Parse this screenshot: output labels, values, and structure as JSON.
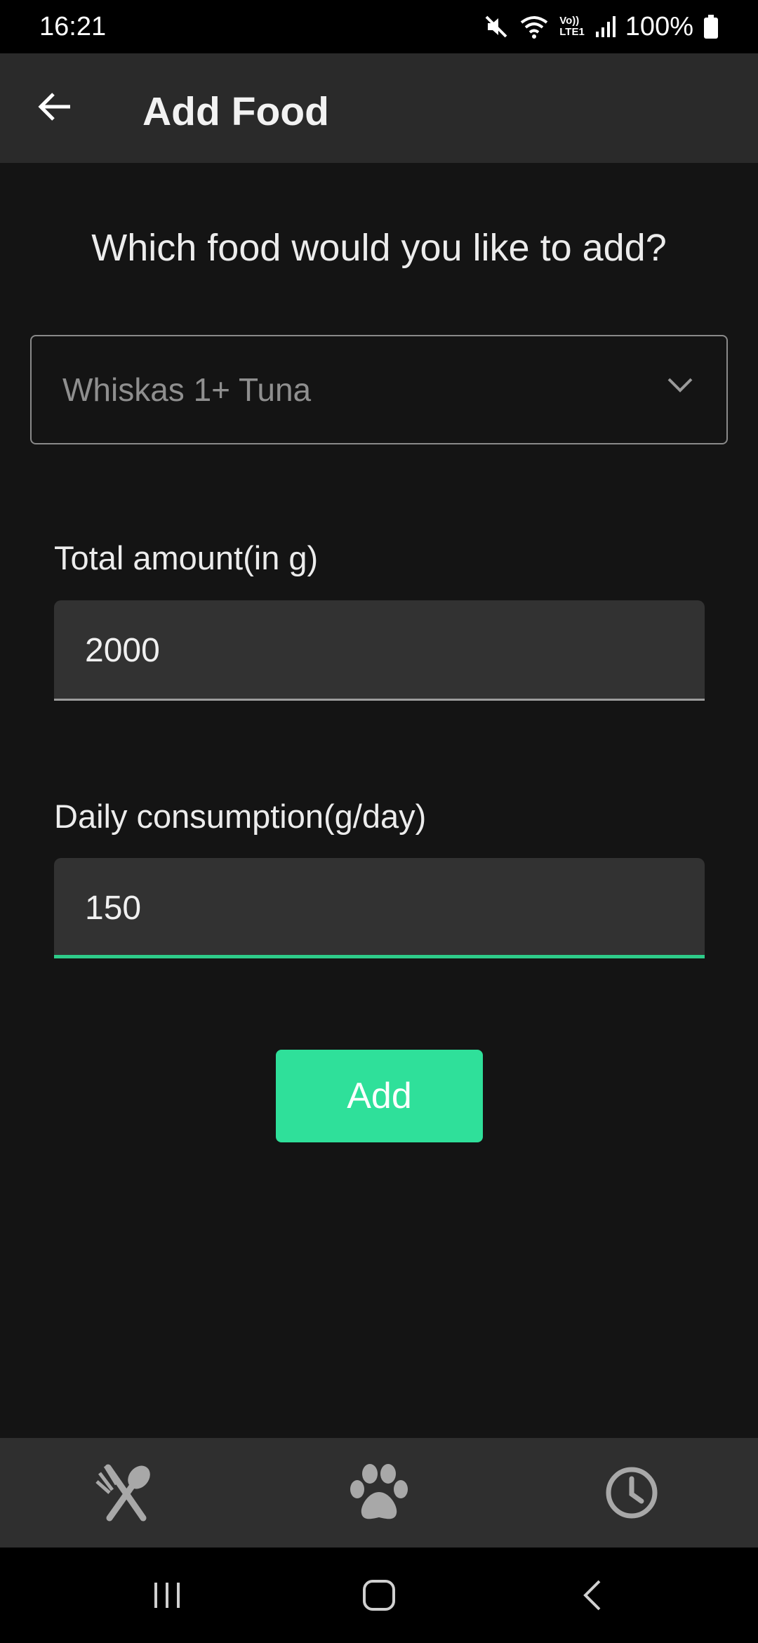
{
  "status_bar": {
    "time": "16:21",
    "battery": "100%",
    "icons": [
      "mute-icon",
      "wifi-icon",
      "volte-lte-icon",
      "signal-icon",
      "battery-icon"
    ],
    "volte_label": "Vo))",
    "lte_label": "LTE1"
  },
  "app_bar": {
    "title": "Add Food",
    "back_icon": "arrow-left-icon"
  },
  "main": {
    "question": "Which food would you like to add?",
    "food_select": {
      "value": "Whiskas 1+ Tuna",
      "icon": "chevron-down-icon"
    },
    "total_amount": {
      "label": "Total amount(in g)",
      "value": "2000"
    },
    "daily_consumption": {
      "label": "Daily consumption(g/day)",
      "value": "150"
    },
    "add_button": "Add"
  },
  "bottom_nav": {
    "items": [
      {
        "icon": "fork-spoon-icon"
      },
      {
        "icon": "paw-icon"
      },
      {
        "icon": "clock-icon"
      }
    ]
  },
  "colors": {
    "accent": "#2fe09a",
    "focus_underline": "#2ecc8a",
    "background": "#141414",
    "app_bar": "#2a2a2a",
    "field_bg": "#323232"
  }
}
